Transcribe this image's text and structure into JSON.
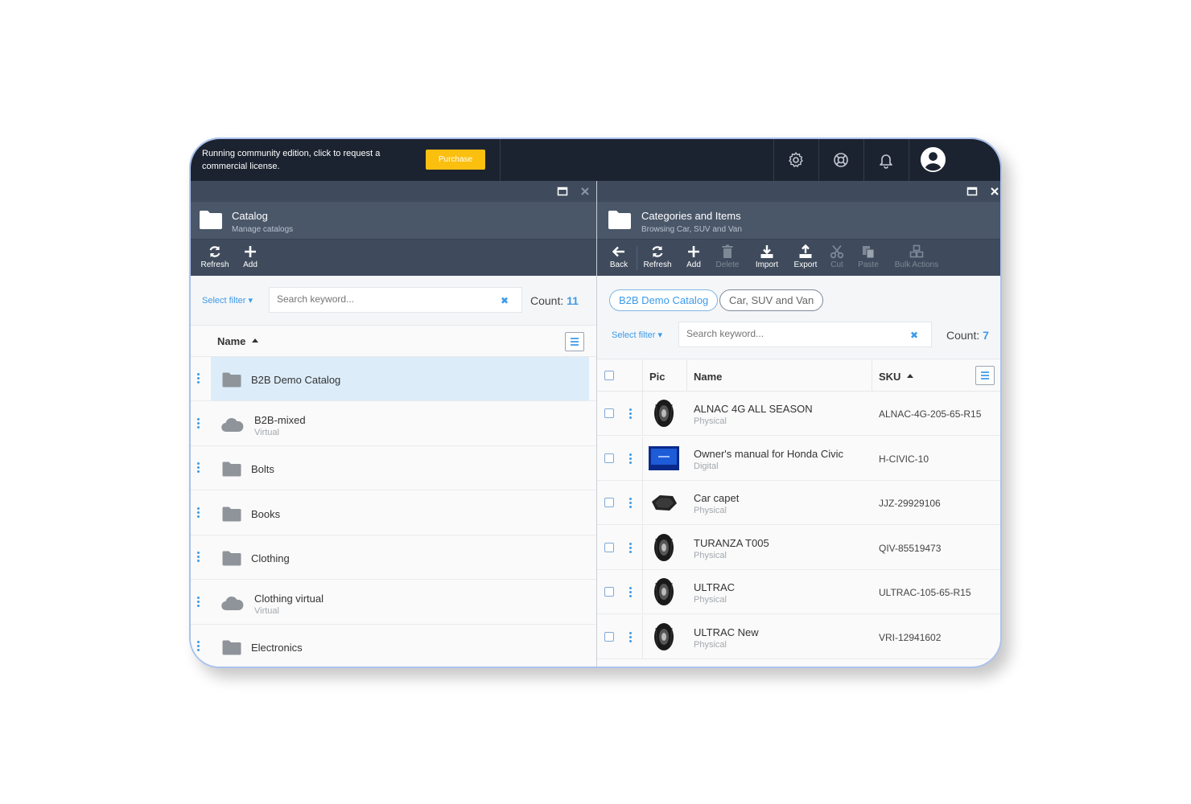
{
  "topbar": {
    "license_text": "Running community edition, click to request a commercial license.",
    "purchase_label": "Purchase",
    "icons": [
      "gear-icon",
      "support-icon",
      "bell-icon",
      "user-avatar-icon"
    ],
    "accent": "#fbbf0f",
    "background": "#1c2330"
  },
  "left_pane": {
    "title": "Catalog",
    "subtitle": "Manage catalogs",
    "toolbar": {
      "refresh": "Refresh",
      "add": "Add"
    },
    "filter_label": "Select filter",
    "search_placeholder": "Search keyword...",
    "count_label": "Count:",
    "count_value": "11",
    "column_name": "Name",
    "rows": [
      {
        "name": "B2B Demo Catalog",
        "sub": "",
        "type": "folder"
      },
      {
        "name": "B2B-mixed",
        "sub": "Virtual",
        "type": "cloud"
      },
      {
        "name": "Bolts",
        "sub": "",
        "type": "folder"
      },
      {
        "name": "Books",
        "sub": "",
        "type": "folder"
      },
      {
        "name": "Clothing",
        "sub": "",
        "type": "folder"
      },
      {
        "name": "Clothing virtual",
        "sub": "Virtual",
        "type": "cloud"
      },
      {
        "name": "Electronics",
        "sub": "",
        "type": "folder"
      }
    ]
  },
  "right_pane": {
    "title": "Categories and Items",
    "subtitle": "Browsing Car, SUV and Van",
    "toolbar": {
      "back": "Back",
      "refresh": "Refresh",
      "add": "Add",
      "delete": "Delete",
      "import": "Import",
      "export": "Export",
      "cut": "Cut",
      "paste": "Paste",
      "bulk": "Bulk Actions"
    },
    "breadcrumb": [
      "B2B Demo Catalog",
      "Car, SUV and Van"
    ],
    "filter_label": "Select filter",
    "search_placeholder": "Search keyword...",
    "count_label": "Count:",
    "count_value": "7",
    "columns": {
      "pic": "Pic",
      "name": "Name",
      "sku": "SKU"
    },
    "rows": [
      {
        "name": "ALNAC 4G ALL SEASON",
        "sub": "Physical",
        "sku": "ALNAC-4G-205-65-R15",
        "pic": "tire-icon"
      },
      {
        "name": "Owner's manual for Honda Civic",
        "sub": "Digital",
        "sku": "H-CIVIC-10",
        "pic": "manual-icon"
      },
      {
        "name": "Car capet",
        "sub": "Physical",
        "sku": "JJZ-29929106",
        "pic": "carpet-icon"
      },
      {
        "name": "TURANZA T005",
        "sub": "Physical",
        "sku": "QIV-85519473",
        "pic": "tire-icon"
      },
      {
        "name": "ULTRAC",
        "sub": "Physical",
        "sku": "ULTRAC-105-65-R15",
        "pic": "tire-icon"
      },
      {
        "name": "ULTRAC New",
        "sub": "Physical",
        "sku": "VRI-12941602",
        "pic": "tire-icon"
      }
    ]
  },
  "colors": {
    "accent_blue": "#3d9be9",
    "header": "#4a5769",
    "toolbar": "#3f4b5c",
    "selected_row": "#dcecf9"
  }
}
